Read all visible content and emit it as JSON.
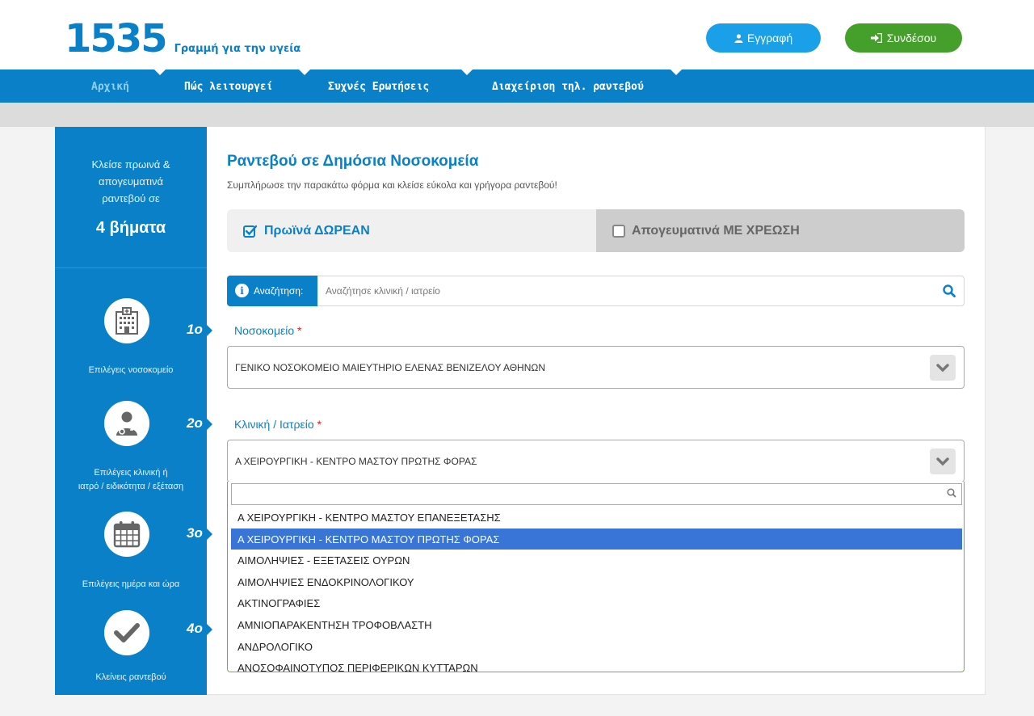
{
  "header": {
    "logo_number": "1535",
    "logo_text": "Γραμμή για την υγεία",
    "register_label": "Εγγραφή",
    "login_label": "Συνδέσου"
  },
  "nav": {
    "items": [
      {
        "label": "Αρχική",
        "active": true
      },
      {
        "label": "Πώς λειτουργεί"
      },
      {
        "label": "Συχνές Ερωτήσεις"
      },
      {
        "label": "Διαχείριση τηλ. ραντεβού"
      }
    ]
  },
  "sidebar": {
    "intro_lines": [
      "Κλείσε πρωινά &",
      "απογευματινά",
      "ραντεβού σε"
    ],
    "steps_title": "4 βήματα",
    "steps": [
      {
        "number": "1ο",
        "label": [
          "Επιλέγεις νοσοκομείο"
        ],
        "icon": "hospital-icon"
      },
      {
        "number": "2ο",
        "label": [
          "Επιλέγεις κλινική ή",
          "ιατρό / ειδικότητα / εξέταση"
        ],
        "icon": "doctor-icon"
      },
      {
        "number": "3ο",
        "label": [
          "Επιλέγεις ημέρα και ώρα"
        ],
        "icon": "calendar-icon"
      },
      {
        "number": "4ο",
        "label": [
          "Κλείνεις ραντεβού"
        ],
        "icon": "check-icon"
      }
    ]
  },
  "content": {
    "title": "Ραντεβού σε Δημόσια Νοσοκομεία",
    "subtitle": "Συμπλήρωσε την παρακάτω φόρμα και κλείσε εύκολα και γρήγορα ραντεβού!",
    "tab_free": "Πρωϊνά ΔΩΡΕΑΝ",
    "tab_paid": "Απογευματινά ΜΕ ΧΡΕΩΣΗ",
    "search_label": "Αναζήτηση:",
    "search_placeholder": "Αναζήτησε κλινική / ιατρείο",
    "hospital_label": "Νοσοκομείο",
    "hospital_value": "ΓΕΝΙΚΟ ΝΟΣΟΚΟΜΕΙΟ ΜΑΙΕΥΤΗΡΙΟ ΕΛΕΝΑΣ ΒΕΝΙΖΕΛΟΥ ΑΘΗΝΩΝ",
    "clinic_label": "Κλινική / Ιατρείο",
    "clinic_value": "Α ΧΕΙΡΟΥΡΓΙΚΗ - ΚΕΝΤΡΟ ΜΑΣΤΟΥ ΠΡΩΤΗΣ ΦΟΡΑΣ",
    "required_mark": "*"
  },
  "dropdown": {
    "options": [
      "Α ΧΕΙΡΟΥΡΓΙΚΗ - ΚΕΝΤΡΟ ΜΑΣΤΟΥ ΕΠΑΝΕΞΕΤΑΣΗΣ",
      "Α ΧΕΙΡΟΥΡΓΙΚΗ - ΚΕΝΤΡΟ ΜΑΣΤΟΥ ΠΡΩΤΗΣ ΦΟΡΑΣ",
      "ΑΙΜΟΛΗΨΙΕΣ - ΕΞΕΤΑΣΕΙΣ ΟΥΡΩΝ",
      "ΑΙΜΟΛΗΨΙΕΣ ΕΝΔΟΚΡΙΝΟΛΟΓΙΚΟΥ",
      "ΑΚΤΙΝΟΓΡΑΦΙΕΣ",
      "ΑΜΝΙΟΠΑΡΑΚΕΝΤΗΣΗ ΤΡΟΦΟΒΛΑΣΤΗ",
      "ΑΝΔΡΟΛΟΓΙΚΟ",
      "ΑΝΟΣΟΦΑΙΝΟΤΥΠΟΣ ΠΕΡΙΦΕΡΙΚΩΝ ΚΥΤΤΑΡΩΝ"
    ],
    "selected_index": 1
  },
  "colors": {
    "brand_blue": "#0a80c8",
    "register_blue": "#1aa0e8",
    "login_green": "#44a02b",
    "selected_option": "#3875d7"
  }
}
